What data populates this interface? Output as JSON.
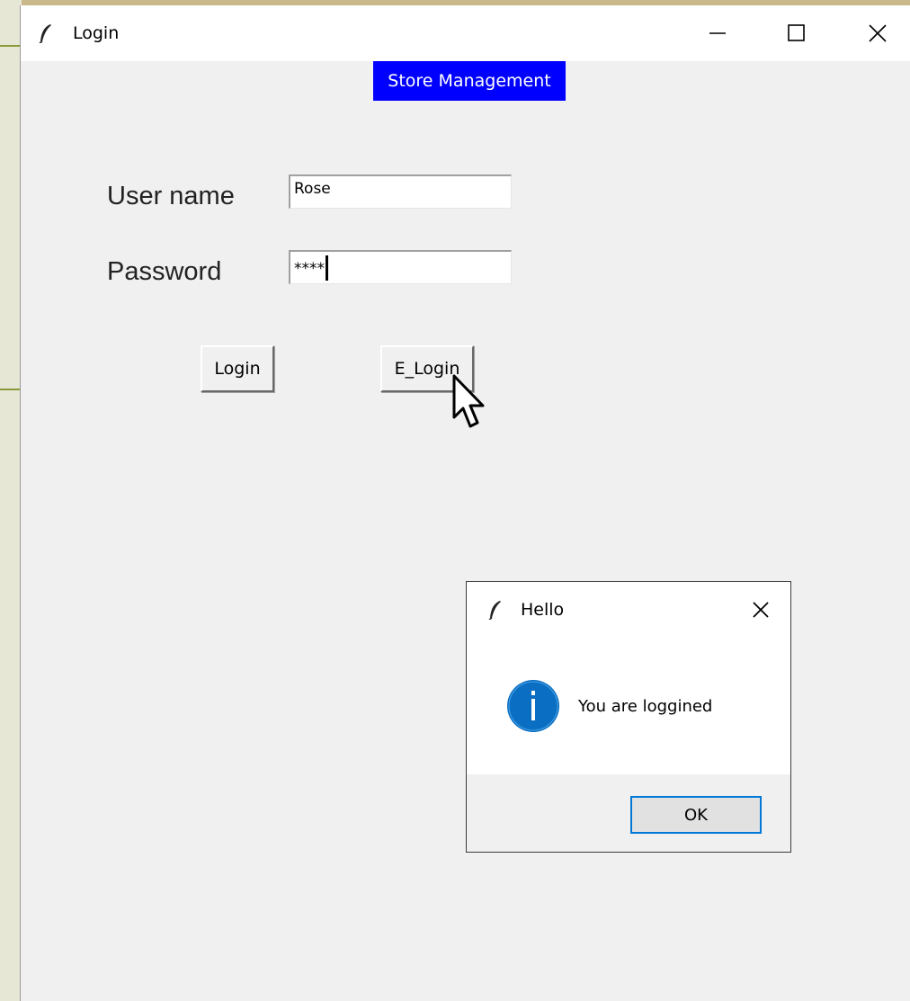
{
  "window": {
    "title": "Login",
    "banner": "Store Management"
  },
  "form": {
    "username_label": "User name",
    "username_value": "Rose",
    "password_label": "Password",
    "password_value": "****",
    "login_button": "Login",
    "e_login_button": "E_Login"
  },
  "dialog": {
    "title": "Hello",
    "message": "You are loggined",
    "ok_button": "OK"
  },
  "colors": {
    "banner_bg": "#0000ff",
    "banner_fg": "#ffffff",
    "ok_focus": "#0078d7",
    "info_icon": "#0a6fc2"
  },
  "icons": [
    "feather-icon",
    "minimize-icon",
    "maximize-icon",
    "close-icon",
    "info-icon",
    "mouse-cursor-icon"
  ]
}
